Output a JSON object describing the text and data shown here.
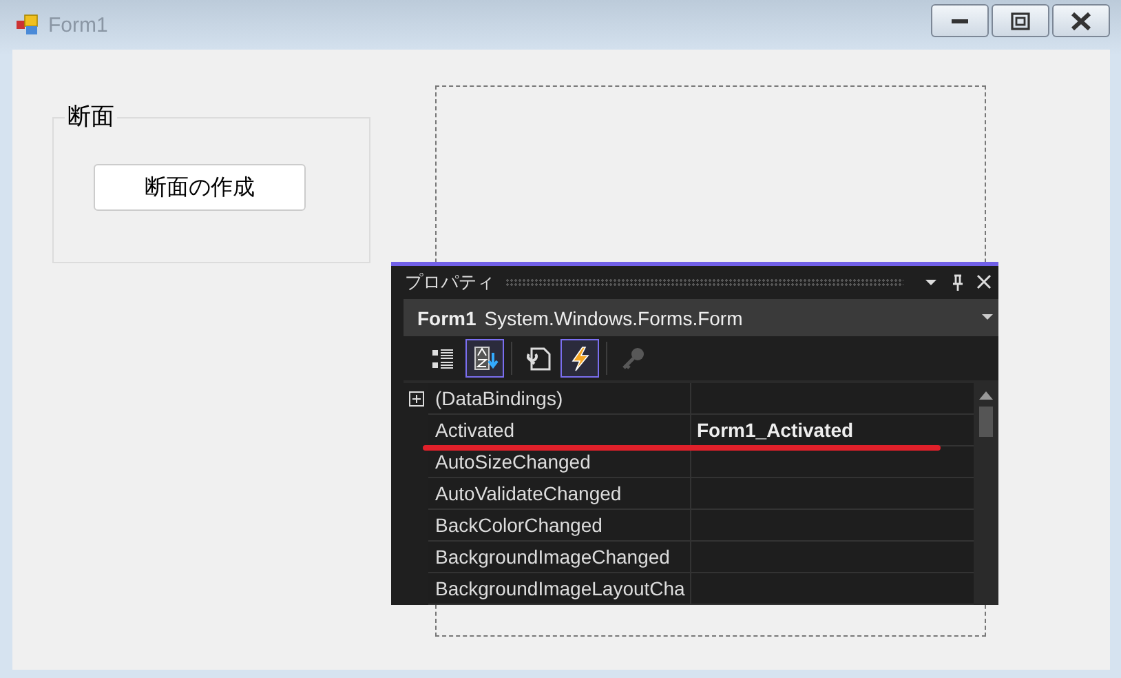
{
  "window": {
    "title": "Form1"
  },
  "group_box": {
    "title": "断面",
    "button": "断面の作成"
  },
  "properties_panel": {
    "title": "プロパティ",
    "object_name": "Form1",
    "object_type": "System.Windows.Forms.Form",
    "toolbar": [
      {
        "kind": "categorized",
        "selected": false,
        "disabled": false
      },
      {
        "kind": "alphabetical",
        "selected": true,
        "disabled": false
      },
      {
        "kind": "properties",
        "selected": false,
        "disabled": false
      },
      {
        "kind": "events",
        "selected": true,
        "disabled": false
      },
      {
        "kind": "pages",
        "selected": false,
        "disabled": true
      }
    ],
    "rows": [
      {
        "name": "(DataBindings)",
        "expanded": false,
        "underlined": false
      },
      {
        "name": "Activated",
        "value": "Form1_Activated",
        "underlined": true
      },
      {
        "name": "AutoSizeChanged",
        "underlined": false
      },
      {
        "name": "AutoValidateChanged",
        "underlined": false
      },
      {
        "name": "BackColorChanged",
        "underlined": false
      },
      {
        "name": "BackgroundImageChanged",
        "underlined": false
      },
      {
        "name": "BackgroundImageLayoutCha",
        "underlined": false
      }
    ]
  }
}
